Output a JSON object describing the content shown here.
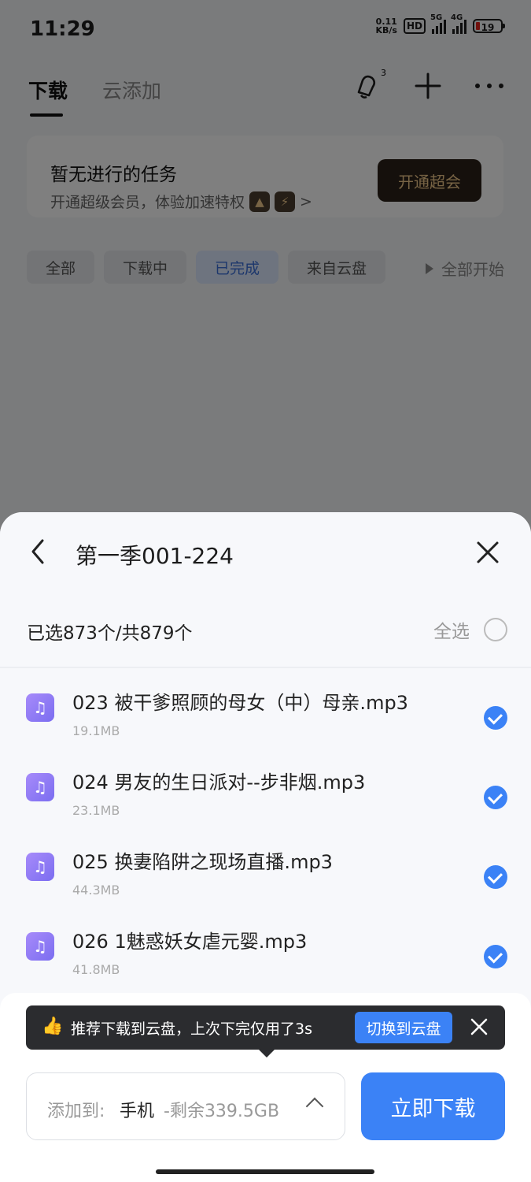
{
  "status": {
    "time": "11:29",
    "net_speed": "0.11",
    "net_unit": "KB/s",
    "hd": "HD",
    "sig1": "5G",
    "sig2": "4G",
    "battery": "19"
  },
  "header": {
    "tabs": [
      {
        "label": "下载"
      },
      {
        "label": "云添加"
      }
    ],
    "bell_count": "3"
  },
  "promo": {
    "title": "暂无进行的任务",
    "subtitle": "开通超级会员，体验加速特权",
    "arrow": ">",
    "button": "开通超会"
  },
  "filters": {
    "chips": [
      {
        "label": "全部"
      },
      {
        "label": "下载中"
      },
      {
        "label": "已完成"
      },
      {
        "label": "来自云盘"
      }
    ],
    "start_all": "全部开始"
  },
  "sheet": {
    "title": "第一季001-224",
    "selection": "已选873个/共879个",
    "select_all": "全选",
    "files": [
      {
        "name": "023 被干爹照顾的母女（中）母亲.mp3",
        "size": "19.1MB"
      },
      {
        "name": "024 男友的生日派对--步非烟.mp3",
        "size": "23.1MB"
      },
      {
        "name": "025 换妻陷阱之现场直播.mp3",
        "size": "44.3MB"
      },
      {
        "name": "026 1魅惑妖女虐元婴.mp3",
        "size": "41.8MB"
      }
    ]
  },
  "tip": {
    "icon": "👍",
    "text": "推荐下载到云盘，上次下完仅用了3s",
    "button": "切换到云盘"
  },
  "footer": {
    "dest_prefix": "添加到:",
    "dest_value": "手机",
    "dest_free": "-剩余339.5GB",
    "download": "立即下载"
  }
}
